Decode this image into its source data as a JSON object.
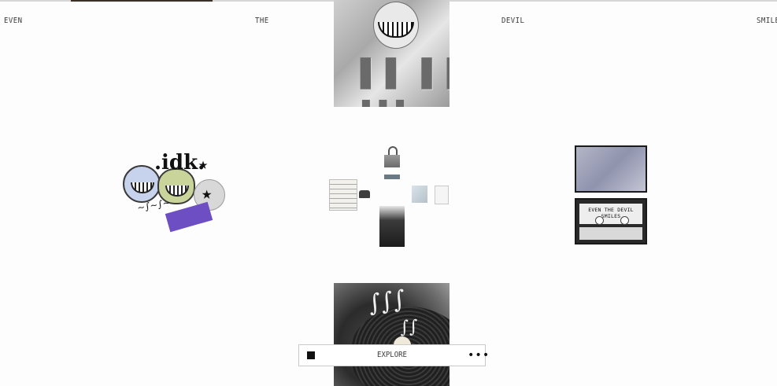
{
  "header": {
    "words": [
      "EVEN",
      "THE",
      "DEVIL",
      "SMILES"
    ]
  },
  "stickers": {
    "idk_text": ".idk."
  },
  "tape": {
    "label": "EVEN THE DEVIL SMILES"
  },
  "controls": {
    "explore_label": "EXPLORE",
    "more_label": "•••"
  },
  "icons": {
    "stop": "stop-icon",
    "more": "more-dots-icon",
    "lock": "padlock-icon",
    "phone": "phone-icon"
  },
  "colors": {
    "background": "#fdfdfd",
    "sticker_purple": "#6e4fc3",
    "sticker_green": "#c9d49a",
    "sticker_blue": "#c7d3ec"
  }
}
